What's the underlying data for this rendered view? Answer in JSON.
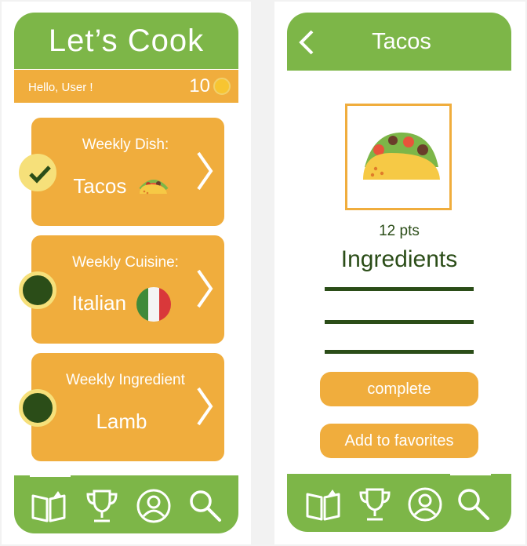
{
  "home": {
    "title": "Let’s Cook",
    "greeting": "Hello, User !",
    "coins": "10",
    "cards": [
      {
        "title": "Weekly Dish:",
        "value": "Tacos",
        "status": "completed"
      },
      {
        "title": "Weekly Cuisine:",
        "value": "Italian",
        "status": "pending"
      },
      {
        "title": "Weekly Ingredient",
        "value": "Lamb",
        "status": "pending"
      }
    ],
    "nav": [
      "book-icon",
      "trophy-icon",
      "profile-icon",
      "search-icon"
    ],
    "active_nav": "book-icon"
  },
  "detail": {
    "title": "Tacos",
    "points": "12 pts",
    "ingredients_title": "Ingredients",
    "ingredient_lines": 3,
    "complete_label": "complete",
    "favorite_label": "Add to favorites",
    "nav": [
      "book-icon",
      "trophy-icon",
      "profile-icon",
      "search-icon"
    ],
    "active_nav": "search-icon"
  },
  "colors": {
    "green": "#7db648",
    "orange": "#f0ad3d",
    "dark_green": "#2b4d18",
    "yellow": "#f6e07a"
  }
}
